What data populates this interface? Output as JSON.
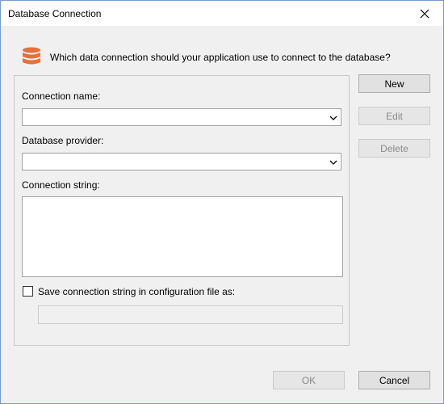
{
  "window": {
    "title": "Database Connection"
  },
  "prompt": {
    "text": "Which data connection should your application use to connect to the database?",
    "icon": "database-icon",
    "icon_color": "#e8703a"
  },
  "form": {
    "connection_name_label": "Connection name:",
    "connection_name_value": "",
    "database_provider_label": "Database provider:",
    "database_provider_value": "",
    "connection_string_label": "Connection string:",
    "connection_string_value": "",
    "save_checkbox_label": "Save connection string in configuration file as:",
    "save_checkbox_checked": false,
    "config_name_value": ""
  },
  "side_buttons": {
    "new": "New",
    "edit": "Edit",
    "delete": "Delete"
  },
  "footer_buttons": {
    "ok": "OK",
    "cancel": "Cancel"
  }
}
